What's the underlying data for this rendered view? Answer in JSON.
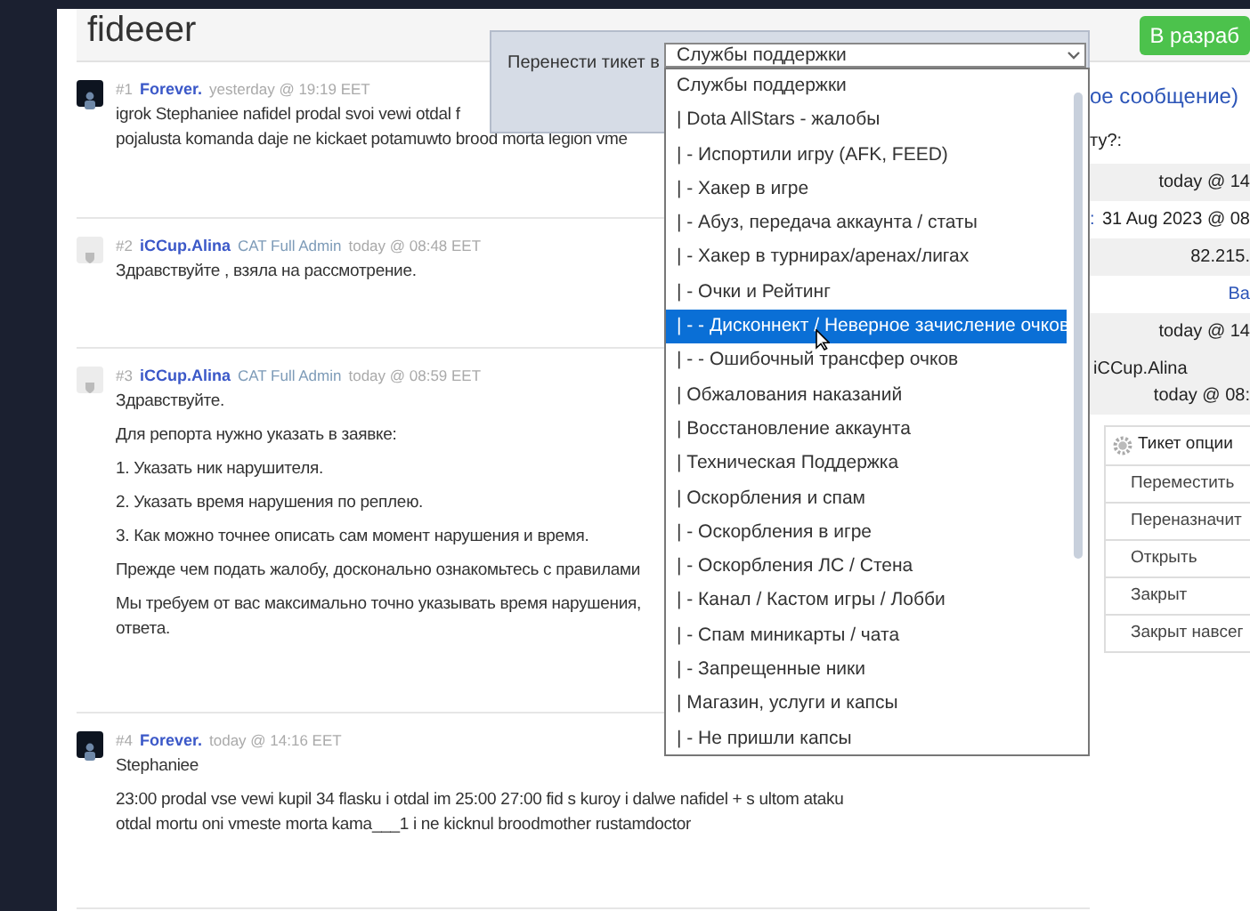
{
  "page_title": "fideeer",
  "status_badge": "В разраб",
  "posts": [
    {
      "number": "#1",
      "author": "Forever.",
      "time": "yesterday @ 19:19 EET",
      "avatar": {
        "kind": "dark"
      },
      "paragraphs": [
        [
          "igrok Stephaniee nafidel prodal svoi vewi otdal f",
          "pojalusta komanda daje ne kickaet potamuwto brood morta legion vme"
        ]
      ]
    },
    {
      "number": "#2",
      "author": "iCCup.Alina",
      "role": "CAT Full Admin",
      "time": "today @ 08:48 EET",
      "avatar": {
        "kind": "light"
      },
      "paragraphs": [
        [
          "Здравствуйте , взяла на рассмотрение."
        ]
      ]
    },
    {
      "number": "#3",
      "author": "iCCup.Alina",
      "role": "CAT Full Admin",
      "time": "today @ 08:59 EET",
      "avatar": {
        "kind": "light"
      },
      "paragraphs": [
        [
          "Здравствуйте."
        ],
        [
          "Для репорта нужно указать в заявке:"
        ],
        [
          "1. Указать ник нарушителя."
        ],
        [
          "2. Указать время нарушения по реплею."
        ],
        [
          "3. Как можно точнее описать сам момент нарушения и время."
        ],
        [
          "Прежде чем подать жалобу, досконально ознакомьтесь с правилами"
        ],
        [
          "Мы требуем от вас максимально точно указывать время нарушения,",
          "ответа."
        ]
      ]
    },
    {
      "number": "#4",
      "author": "Forever.",
      "time": "today @ 14:16 EET",
      "avatar": {
        "kind": "dark"
      },
      "paragraphs": [
        [
          "Stephaniee"
        ],
        [
          "23:00 prodal vse vewi kupil 34 flasku i otdal im 25:00 27:00 fid s kuroy i dalwe nafidel + s ultom ataku",
          "otdal mortu oni vmeste morta kama___1 i ne kicknul broodmother rustamdoctor"
        ]
      ]
    }
  ],
  "details": [
    {
      "kind": "link",
      "text": "ое сообщение)"
    },
    {
      "kind": "label",
      "text": "ту?:"
    },
    {
      "kind": "row",
      "shaded": true,
      "text": "today @ 14"
    },
    {
      "kind": "row",
      "shaded": false,
      "label": ":",
      "text": "31 Aug 2023 @ 08"
    },
    {
      "kind": "row",
      "shaded": true,
      "text": "82.215."
    },
    {
      "kind": "linkrow",
      "shaded": false,
      "text": "Ва"
    },
    {
      "kind": "row",
      "shaded": true,
      "text": "today @ 14"
    },
    {
      "kind": "pair",
      "shaded": true,
      "label": "iCCup.Alina",
      "text": "today @ 08:"
    }
  ],
  "ticket_options": {
    "title": "Тикет опции",
    "items": [
      "Переместить",
      "Переназначит",
      "Открыть",
      "Закрыт",
      "Закрыт навсег"
    ]
  },
  "move_dialog": {
    "label": "Перенести тикет в",
    "value": "Службы поддержки",
    "options": [
      {
        "label": "Службы поддержки",
        "highlighted": false
      },
      {
        "label": "| Dota AllStars - жалобы",
        "highlighted": false
      },
      {
        "label": "| - Испортили игру (AFK, FEED)",
        "highlighted": false
      },
      {
        "label": "| - Хакер в игре",
        "highlighted": false
      },
      {
        "label": "| - Абуз, передача аккаунта / статы",
        "highlighted": false
      },
      {
        "label": "| - Хакер в турнирах/аренах/лигах",
        "highlighted": false
      },
      {
        "label": "| - Очки и Рейтинг",
        "highlighted": false
      },
      {
        "label": "| - - Дисконнект / Неверное зачисление очков",
        "highlighted": true
      },
      {
        "label": "| - - Ошибочный трансфер очков",
        "highlighted": false
      },
      {
        "label": "| Обжалования наказаний",
        "highlighted": false
      },
      {
        "label": "| Восстановление аккаунта",
        "highlighted": false
      },
      {
        "label": "| Техническая Поддержка",
        "highlighted": false
      },
      {
        "label": "| Оскорбления и спам",
        "highlighted": false
      },
      {
        "label": "| - Оскорбления в игре",
        "highlighted": false
      },
      {
        "label": "| - Оскорбления ЛС / Стена",
        "highlighted": false
      },
      {
        "label": "| - Канал / Кастом игры / Лобби",
        "highlighted": false
      },
      {
        "label": "| - Спам миникарты / чата",
        "highlighted": false
      },
      {
        "label": "| - Запрещенные ники",
        "highlighted": false
      },
      {
        "label": "| Магазин, услуги и капсы",
        "highlighted": false
      },
      {
        "label": "| - Не пришли капсы",
        "highlighted": false
      }
    ]
  }
}
